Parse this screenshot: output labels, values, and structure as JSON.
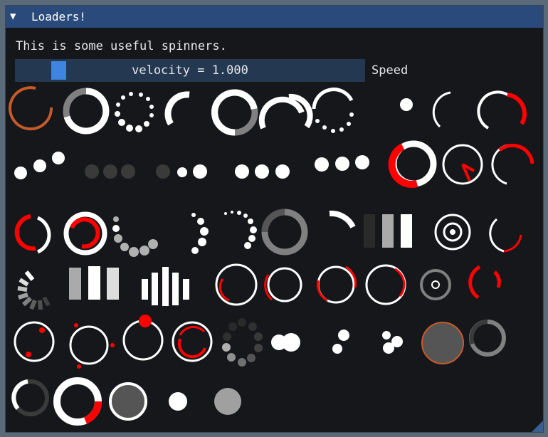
{
  "window": {
    "title": "Loaders!",
    "description": "This is some useful spinners.",
    "slider": {
      "text": "velocity = 1.000",
      "label": "Speed",
      "value": 1.0
    }
  },
  "icons": {
    "collapse": "triangle-down-icon",
    "resize": "resize-grip-icon"
  },
  "colors": {
    "title_bar": "#294a7a",
    "window_bg": "#15171b",
    "slider_bg": "#243852",
    "slider_grab": "#3d85e0",
    "accent_red": "#ff0000",
    "accent_orange": "#c85a2a",
    "white": "#ffffff",
    "gray": "#808080"
  }
}
